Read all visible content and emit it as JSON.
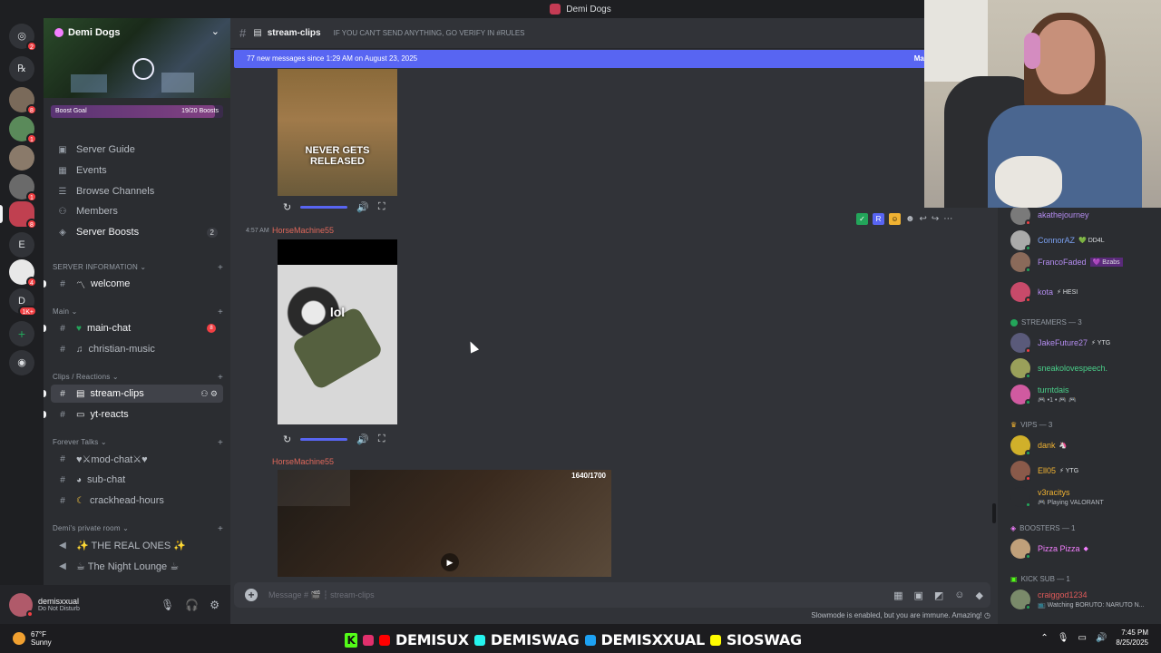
{
  "window": {
    "title": "Demi Dogs"
  },
  "rail": {
    "servers": [
      {
        "badge": "2"
      },
      {
        "badge": ""
      },
      {
        "badge": "8"
      },
      {
        "badge": "1"
      },
      {
        "badge": ""
      },
      {
        "badge": "1"
      },
      {
        "badge": "8"
      },
      {
        "label": "E"
      },
      {
        "badge": "4"
      },
      {
        "label": "D",
        "badge": "1K+"
      }
    ]
  },
  "server": {
    "name": "Demi Dogs",
    "boost_label": "Boost Goal",
    "boost_count": "19/20 Boosts",
    "boost_progress": 0.95
  },
  "nav": {
    "server_guide": "Server Guide",
    "events": "Events",
    "browse_channels": "Browse Channels",
    "members": "Members",
    "server_boosts": "Server Boosts",
    "server_boosts_count": "2"
  },
  "categories": {
    "server_information": "SERVER INFORMATION",
    "main": "Main",
    "clips": "Clips / Reactions",
    "forever_talks": "Forever Talks",
    "private_room": "Demi's private room"
  },
  "channels": {
    "welcome": "welcome",
    "main_chat": "main-chat",
    "main_chat_badge": "8",
    "christian_music": "christian-music",
    "stream_clips": "stream-clips",
    "yt_reacts": "yt-reacts",
    "mod_chat": "♥⚔mod-chat⚔♥",
    "sub_chat": "sub-chat",
    "crackhead_hours": "crackhead-hours",
    "real_ones": "✨ THE REAL ONES ✨",
    "night_lounge": "☕ The Night Lounge ☕"
  },
  "user": {
    "name": "demisxxual",
    "status": "Do Not Disturb"
  },
  "chat": {
    "channel": "stream-clips",
    "topic": "IF YOU CAN'T SEND ANYTHING, GO VERIFY IN #RULES",
    "new_messages": "77 new messages since 1:29 AM on August 23, 2025",
    "mark_as_read": "Mar",
    "video1_caption": "NEVER GETS RELEASED",
    "message2_time": "4:57 AM",
    "message2_author": "HorseMachine55",
    "video2_caption": "lol",
    "message3_author": "HorseMachine55",
    "video3_counter": "1640/1700",
    "composer_placeholder": "Message #  🎬 ┆ stream-clips",
    "slowmode": "Slowmode is enabled, but you are immune. Amazing!"
  },
  "members": {
    "online": [
      {
        "name": "akathejourney",
        "tag": ""
      },
      {
        "name": "ConnorAZ",
        "tag": "💚 DD4L"
      },
      {
        "name": "FrancoFaded",
        "tag": "💜 Bzabs"
      },
      {
        "name": "kota",
        "tag": "⚡ HESI"
      }
    ],
    "streamers_heading": "STREAMERS — 3",
    "streamers": [
      {
        "name": "JakeFuture27",
        "tag": "⚡ YTG"
      },
      {
        "name": "sneakolovespeech.",
        "tag": ""
      },
      {
        "name": "turntdais",
        "sub": "🎮 •1 • 🎮 🎮"
      }
    ],
    "vips_heading": "VIPS — 3",
    "vips": [
      {
        "name": "dank",
        "tag": "🦄"
      },
      {
        "name": "Ell05",
        "tag": "⚡ YTG"
      },
      {
        "name": "v3racitys",
        "sub": "🎮 Playing VALORANT"
      }
    ],
    "boosters_heading": "BOOSTERS — 1",
    "boosters": [
      {
        "name": "Pizza Pizza",
        "tag": "◆"
      }
    ],
    "kick_heading": "KICK SUB — 1",
    "kick": [
      {
        "name": "craiggod1234",
        "sub": "📺 Watching BORUTO: NARUTO N..."
      }
    ]
  },
  "taskbar": {
    "temp": "67°F",
    "weather": "Sunny",
    "socials": [
      "DEMISUX",
      "DEMISWAG",
      "DEMISXXUAL",
      "SIOSWAG"
    ],
    "time": "7:45 PM",
    "date": "8/25/2025"
  },
  "colors": {
    "blurple": "#5865f2",
    "author": "#e0685b",
    "online": "#23a55a",
    "dnd": "#f23f43"
  }
}
